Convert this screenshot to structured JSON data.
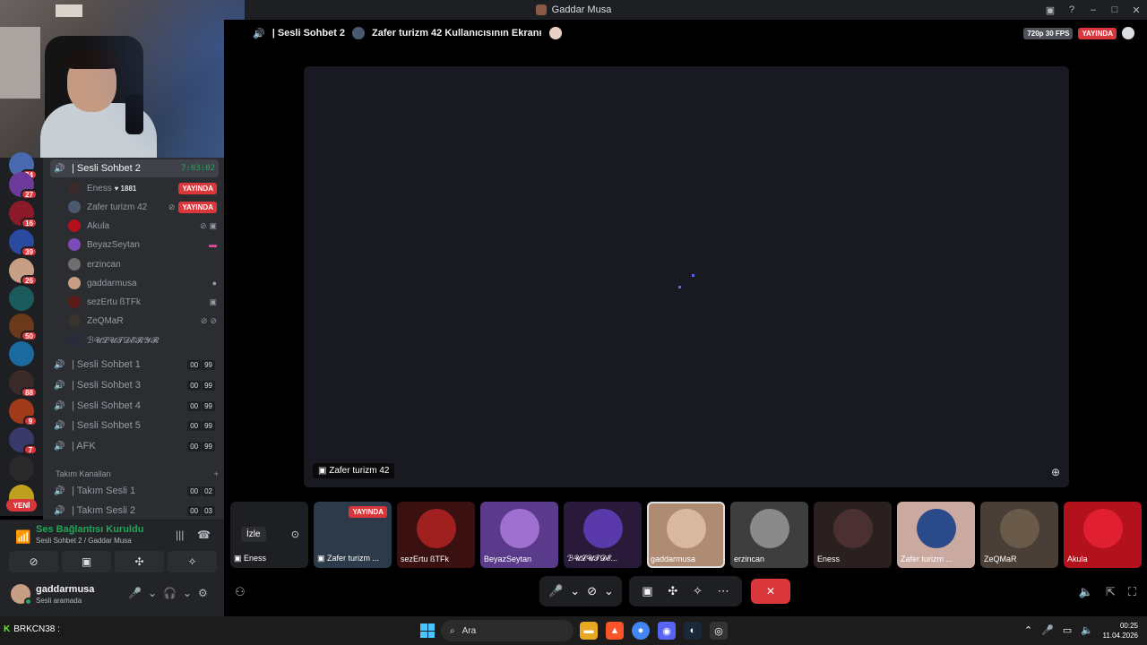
{
  "window": {
    "title": "Gaddar Musa"
  },
  "stage": {
    "channel": "| Sesli Sohbet 2",
    "screen_title": "Zafer turizm 42 Kullanıcısının Ekranı",
    "quality": "720p 30 FPS",
    "live": "YAYINDA",
    "screen_label": "Zafer turizm 42"
  },
  "servers": {
    "badges": [
      "24",
      "27",
      "16",
      "39",
      "26",
      "50",
      "88",
      "9",
      "7"
    ],
    "new_label": "YENİ"
  },
  "active_channel": {
    "name": "| Sesli Sohbet 2",
    "time": "7:03:02"
  },
  "members": [
    {
      "name": "Eness",
      "extra": "♥ 1881",
      "live": "YAYINDA",
      "color": "#3b2a2a"
    },
    {
      "name": "Zafer turizm 42",
      "extra": "",
      "live": "YAYINDA",
      "color": "#4a5970"
    },
    {
      "name": "Akula",
      "extra": "",
      "live": "",
      "color": "#b3121c"
    },
    {
      "name": "BeyazSeytan",
      "extra": "",
      "live": "",
      "color": "#7b4bb8"
    },
    {
      "name": "erzincan",
      "extra": "",
      "live": "",
      "color": "#6e6e6e"
    },
    {
      "name": "gaddarmusa",
      "extra": "",
      "live": "",
      "color": "#c79f85"
    },
    {
      "name": "sezErtu ßTFk",
      "extra": "",
      "live": "",
      "color": "#5a1a1a"
    },
    {
      "name": "ZeQMaR",
      "extra": "",
      "live": "",
      "color": "#3a3430"
    },
    {
      "name": "ℬ𝓤𝓛𝓤𝓣𝓓𝓔𝓡𝓨𝓡",
      "extra": "",
      "live": "",
      "color": "#2a2a3a"
    }
  ],
  "other_channels": [
    {
      "name": "| Sesli Sohbet 1",
      "a": "00",
      "b": "99"
    },
    {
      "name": "| Sesli Sohbet 3",
      "a": "00",
      "b": "99"
    },
    {
      "name": "| Sesli Sohbet 4",
      "a": "00",
      "b": "99"
    },
    {
      "name": "| Sesli Sohbet 5",
      "a": "00",
      "b": "99"
    },
    {
      "name": "| AFK",
      "a": "00",
      "b": "99"
    }
  ],
  "team_category": "Takım Kanalları",
  "team_channels": [
    {
      "name": "| Takım Sesli 1",
      "a": "00",
      "b": "02"
    },
    {
      "name": "| Takım Sesli 2",
      "a": "00",
      "b": "03"
    }
  ],
  "voice_panel": {
    "status": "Ses Bağlantısı Kuruldu",
    "sub": "Sesli Sohbet 2 / Gaddar Musa"
  },
  "user_panel": {
    "name": "gaddarmusa",
    "status": "Sesli aramada"
  },
  "thumbnails": {
    "watch_label": "İzle",
    "watch_user": "Eness",
    "items": [
      {
        "name": "Zafer turizm ...",
        "live": "YAYINDA",
        "color": "#2c3a4a"
      },
      {
        "name": "sezErtu ßTFk",
        "live": "",
        "color": "#3a1010"
      },
      {
        "name": "BeyazSeytan",
        "live": "",
        "color": "#5a3a8a"
      },
      {
        "name": "ℬ𝓤𝓛𝓤𝓣𝓓𝓔...",
        "live": "",
        "color": "#2a1a3a"
      },
      {
        "name": "gaddarmusa",
        "live": "",
        "color": "#b08b74"
      },
      {
        "name": "erzincan",
        "live": "",
        "color": "#3e3e3e"
      },
      {
        "name": "Eness",
        "live": "",
        "color": "#2a2020"
      },
      {
        "name": "Zafer turizm ...",
        "live": "",
        "color": "#c9a9a0"
      },
      {
        "name": "ZeQMaR",
        "live": "",
        "color": "#4a3f36"
      },
      {
        "name": "Akula",
        "live": "",
        "color": "#b3121c"
      }
    ]
  },
  "taskbar": {
    "widget": "BRKCN38 :",
    "search": "Ara",
    "time": "00:25",
    "date": "11.04.2026"
  }
}
